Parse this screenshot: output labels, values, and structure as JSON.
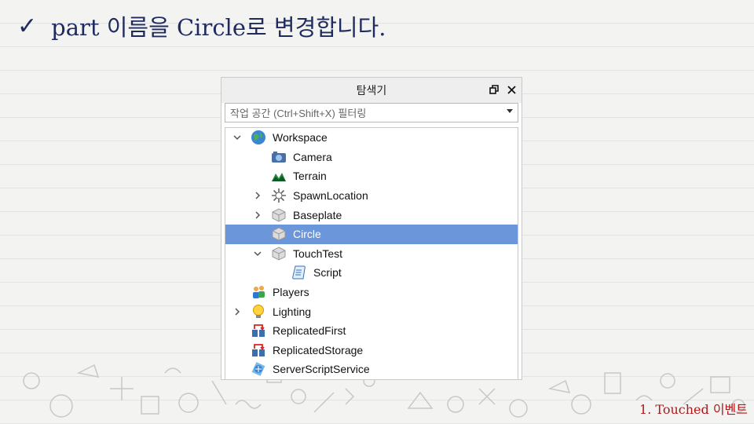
{
  "slide": {
    "title": "part 이름을 Circle로 변경합니다.",
    "footer": "1. Touched 이벤트"
  },
  "explorer": {
    "title": "탐색기",
    "filter_placeholder": "작업 공간 (Ctrl+Shift+X) 필터링",
    "items": [
      {
        "label": "Workspace",
        "icon": "globe-icon",
        "depth": 0,
        "expander": "expanded",
        "selected": false
      },
      {
        "label": "Camera",
        "icon": "camera-icon",
        "depth": 1,
        "expander": "none",
        "selected": false
      },
      {
        "label": "Terrain",
        "icon": "terrain-icon",
        "depth": 1,
        "expander": "none",
        "selected": false
      },
      {
        "label": "SpawnLocation",
        "icon": "spawn-icon",
        "depth": 1,
        "expander": "collapsed",
        "selected": false
      },
      {
        "label": "Baseplate",
        "icon": "part-icon",
        "depth": 1,
        "expander": "collapsed",
        "selected": false
      },
      {
        "label": "Circle",
        "icon": "part-icon",
        "depth": 1,
        "expander": "none",
        "selected": true
      },
      {
        "label": "TouchTest",
        "icon": "part-icon",
        "depth": 1,
        "expander": "expanded",
        "selected": false
      },
      {
        "label": "Script",
        "icon": "script-icon",
        "depth": 2,
        "expander": "none",
        "selected": false
      },
      {
        "label": "Players",
        "icon": "players-icon",
        "depth": 0,
        "expander": "none",
        "selected": false
      },
      {
        "label": "Lighting",
        "icon": "lightbulb-icon",
        "depth": 0,
        "expander": "collapsed",
        "selected": false
      },
      {
        "label": "ReplicatedFirst",
        "icon": "replicated-icon",
        "depth": 0,
        "expander": "none",
        "selected": false
      },
      {
        "label": "ReplicatedStorage",
        "icon": "replicated-icon",
        "depth": 0,
        "expander": "none",
        "selected": false
      },
      {
        "label": "ServerScriptService",
        "icon": "server-script-icon",
        "depth": 0,
        "expander": "none",
        "selected": false
      }
    ]
  },
  "colors": {
    "title": "#1f2a5e",
    "footer": "#b3151a",
    "selection": "#6b96d9"
  }
}
